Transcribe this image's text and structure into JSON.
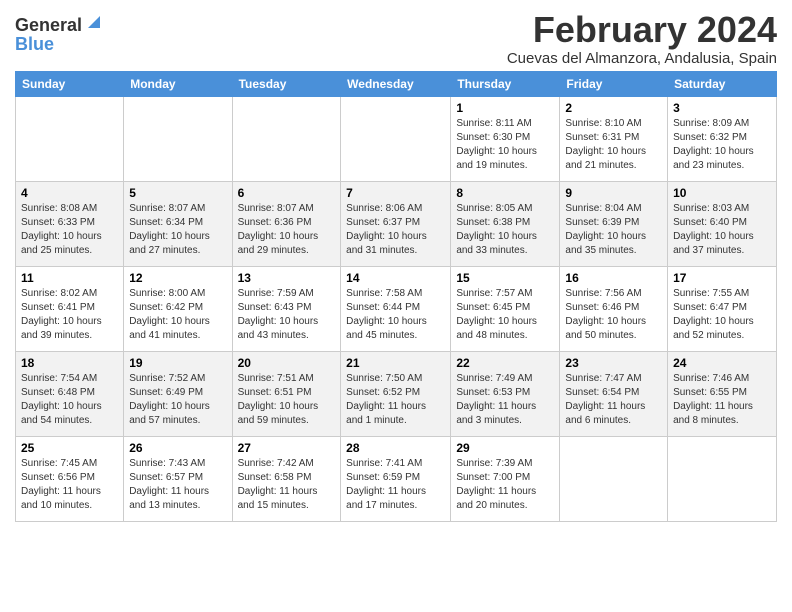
{
  "logo": {
    "general": "General",
    "blue": "Blue"
  },
  "title": "February 2024",
  "subtitle": "Cuevas del Almanzora, Andalusia, Spain",
  "days_of_week": [
    "Sunday",
    "Monday",
    "Tuesday",
    "Wednesday",
    "Thursday",
    "Friday",
    "Saturday"
  ],
  "weeks": [
    [
      {
        "day": "",
        "info": ""
      },
      {
        "day": "",
        "info": ""
      },
      {
        "day": "",
        "info": ""
      },
      {
        "day": "",
        "info": ""
      },
      {
        "day": "1",
        "info": "Sunrise: 8:11 AM\nSunset: 6:30 PM\nDaylight: 10 hours and 19 minutes."
      },
      {
        "day": "2",
        "info": "Sunrise: 8:10 AM\nSunset: 6:31 PM\nDaylight: 10 hours and 21 minutes."
      },
      {
        "day": "3",
        "info": "Sunrise: 8:09 AM\nSunset: 6:32 PM\nDaylight: 10 hours and 23 minutes."
      }
    ],
    [
      {
        "day": "4",
        "info": "Sunrise: 8:08 AM\nSunset: 6:33 PM\nDaylight: 10 hours and 25 minutes."
      },
      {
        "day": "5",
        "info": "Sunrise: 8:07 AM\nSunset: 6:34 PM\nDaylight: 10 hours and 27 minutes."
      },
      {
        "day": "6",
        "info": "Sunrise: 8:07 AM\nSunset: 6:36 PM\nDaylight: 10 hours and 29 minutes."
      },
      {
        "day": "7",
        "info": "Sunrise: 8:06 AM\nSunset: 6:37 PM\nDaylight: 10 hours and 31 minutes."
      },
      {
        "day": "8",
        "info": "Sunrise: 8:05 AM\nSunset: 6:38 PM\nDaylight: 10 hours and 33 minutes."
      },
      {
        "day": "9",
        "info": "Sunrise: 8:04 AM\nSunset: 6:39 PM\nDaylight: 10 hours and 35 minutes."
      },
      {
        "day": "10",
        "info": "Sunrise: 8:03 AM\nSunset: 6:40 PM\nDaylight: 10 hours and 37 minutes."
      }
    ],
    [
      {
        "day": "11",
        "info": "Sunrise: 8:02 AM\nSunset: 6:41 PM\nDaylight: 10 hours and 39 minutes."
      },
      {
        "day": "12",
        "info": "Sunrise: 8:00 AM\nSunset: 6:42 PM\nDaylight: 10 hours and 41 minutes."
      },
      {
        "day": "13",
        "info": "Sunrise: 7:59 AM\nSunset: 6:43 PM\nDaylight: 10 hours and 43 minutes."
      },
      {
        "day": "14",
        "info": "Sunrise: 7:58 AM\nSunset: 6:44 PM\nDaylight: 10 hours and 45 minutes."
      },
      {
        "day": "15",
        "info": "Sunrise: 7:57 AM\nSunset: 6:45 PM\nDaylight: 10 hours and 48 minutes."
      },
      {
        "day": "16",
        "info": "Sunrise: 7:56 AM\nSunset: 6:46 PM\nDaylight: 10 hours and 50 minutes."
      },
      {
        "day": "17",
        "info": "Sunrise: 7:55 AM\nSunset: 6:47 PM\nDaylight: 10 hours and 52 minutes."
      }
    ],
    [
      {
        "day": "18",
        "info": "Sunrise: 7:54 AM\nSunset: 6:48 PM\nDaylight: 10 hours and 54 minutes."
      },
      {
        "day": "19",
        "info": "Sunrise: 7:52 AM\nSunset: 6:49 PM\nDaylight: 10 hours and 57 minutes."
      },
      {
        "day": "20",
        "info": "Sunrise: 7:51 AM\nSunset: 6:51 PM\nDaylight: 10 hours and 59 minutes."
      },
      {
        "day": "21",
        "info": "Sunrise: 7:50 AM\nSunset: 6:52 PM\nDaylight: 11 hours and 1 minute."
      },
      {
        "day": "22",
        "info": "Sunrise: 7:49 AM\nSunset: 6:53 PM\nDaylight: 11 hours and 3 minutes."
      },
      {
        "day": "23",
        "info": "Sunrise: 7:47 AM\nSunset: 6:54 PM\nDaylight: 11 hours and 6 minutes."
      },
      {
        "day": "24",
        "info": "Sunrise: 7:46 AM\nSunset: 6:55 PM\nDaylight: 11 hours and 8 minutes."
      }
    ],
    [
      {
        "day": "25",
        "info": "Sunrise: 7:45 AM\nSunset: 6:56 PM\nDaylight: 11 hours and 10 minutes."
      },
      {
        "day": "26",
        "info": "Sunrise: 7:43 AM\nSunset: 6:57 PM\nDaylight: 11 hours and 13 minutes."
      },
      {
        "day": "27",
        "info": "Sunrise: 7:42 AM\nSunset: 6:58 PM\nDaylight: 11 hours and 15 minutes."
      },
      {
        "day": "28",
        "info": "Sunrise: 7:41 AM\nSunset: 6:59 PM\nDaylight: 11 hours and 17 minutes."
      },
      {
        "day": "29",
        "info": "Sunrise: 7:39 AM\nSunset: 7:00 PM\nDaylight: 11 hours and 20 minutes."
      },
      {
        "day": "",
        "info": ""
      },
      {
        "day": "",
        "info": ""
      }
    ]
  ]
}
